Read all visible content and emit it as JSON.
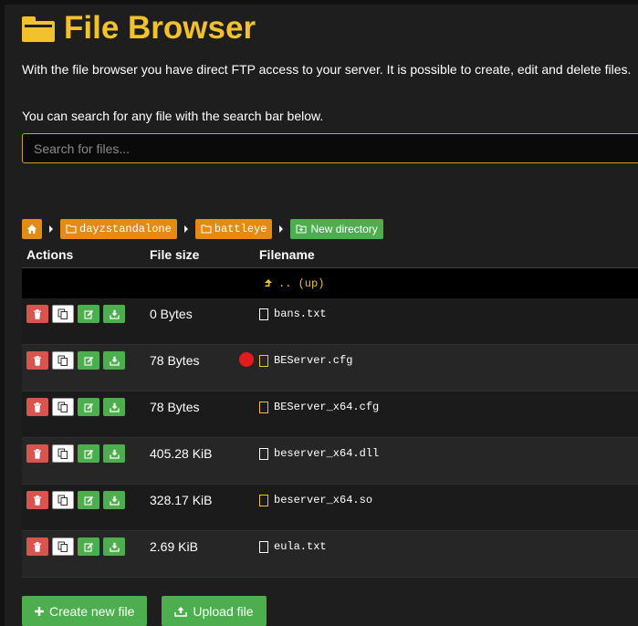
{
  "header": {
    "title": "File Browser",
    "description": "With the file browser you have direct FTP access to your server. It is possible to create, edit and delete files.",
    "search_hint": "You can search for any file with the search bar below."
  },
  "search": {
    "placeholder": "Search for files..."
  },
  "breadcrumb": {
    "items": [
      "dayzstandalone",
      "battleye"
    ],
    "new_directory_label": "New directory"
  },
  "table": {
    "headers": {
      "actions": "Actions",
      "size": "File size",
      "filename": "Filename"
    },
    "up_label": ".. (up)",
    "rows": [
      {
        "size": "0 Bytes",
        "name": "bans.txt",
        "icon": "file-text-icon"
      },
      {
        "size": "78 Bytes",
        "name": "BEServer.cfg",
        "icon": "file-config-icon"
      },
      {
        "size": "78 Bytes",
        "name": "BEServer_x64.cfg",
        "icon": "file-config-icon"
      },
      {
        "size": "405.28 KiB",
        "name": "beserver_x64.dll",
        "icon": "file-icon"
      },
      {
        "size": "328.17 KiB",
        "name": "beserver_x64.so",
        "icon": "file-config-icon"
      },
      {
        "size": "2.69 KiB",
        "name": "eula.txt",
        "icon": "file-text-icon"
      }
    ]
  },
  "footer": {
    "create_label": "Create new file",
    "upload_label": "Upload file"
  },
  "colors": {
    "accent": "#f2c12e",
    "orange": "#e48b14",
    "green": "#4cae4c",
    "red": "#d9534f",
    "background": "#1e1e1e"
  }
}
